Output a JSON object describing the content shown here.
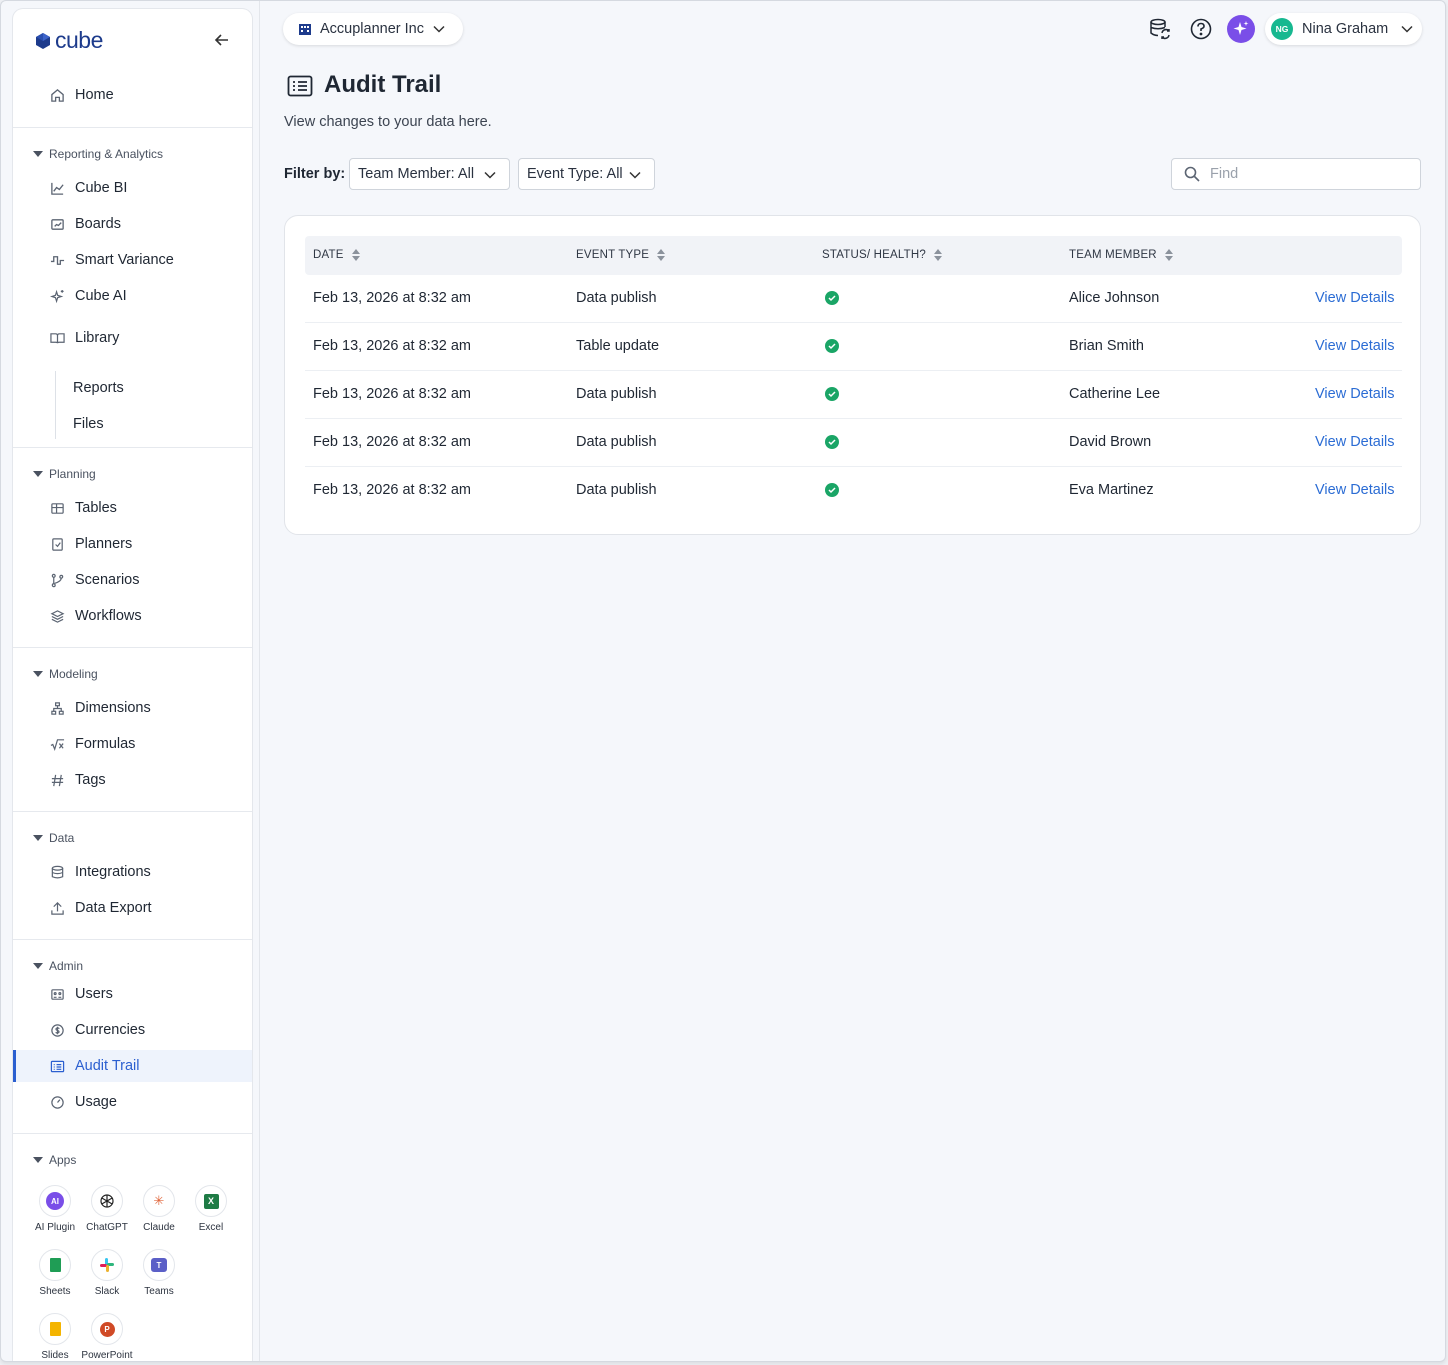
{
  "sidebar": {
    "logo_text": "cube",
    "home": "Home",
    "sections": {
      "reporting": "Reporting & Analytics",
      "planning": "Planning",
      "modeling": "Modeling",
      "data": "Data",
      "admin": "Admin",
      "apps": "Apps"
    },
    "reporting_items": [
      "Cube BI",
      "Boards",
      "Smart Variance",
      "Cube AI",
      "Library"
    ],
    "library_sub": [
      "Reports",
      "Files"
    ],
    "planning_items": [
      "Tables",
      "Planners",
      "Scenarios",
      "Workflows"
    ],
    "modeling_items": [
      "Dimensions",
      "Formulas",
      "Tags"
    ],
    "data_items": [
      "Integrations",
      "Data Export"
    ],
    "admin_items": [
      "Users",
      "Currencies",
      "Audit Trail",
      "Usage"
    ],
    "active_item": "Audit Trail",
    "apps": [
      "AI Plugin",
      "ChatGPT",
      "Claude",
      "Excel",
      "Sheets",
      "Slack",
      "Teams",
      "Slides",
      "PowerPoint"
    ]
  },
  "topbar": {
    "org": "Accuplanner Inc",
    "user_initials": "NG",
    "user_name": "Nina Graham"
  },
  "page": {
    "title": "Audit Trail",
    "subtitle": "View changes to your data here.",
    "filter_label": "Filter by:",
    "team_filter": "Team Member: All",
    "event_filter": "Event Type: All",
    "search_placeholder": "Find"
  },
  "table": {
    "headers": [
      "DATE",
      "EVENT TYPE",
      "STATUS/ HEALTH?",
      "TEAM MEMBER"
    ],
    "rows": [
      {
        "date": "Feb 13, 2026 at 8:32 am",
        "event": "Data publish",
        "status": "ok",
        "member": "Alice Johnson",
        "action": "View Details"
      },
      {
        "date": "Feb 13, 2026 at 8:32 am",
        "event": "Table update",
        "status": "ok",
        "member": "Brian Smith",
        "action": "View Details"
      },
      {
        "date": "Feb 13, 2026 at 8:32 am",
        "event": "Data publish",
        "status": "ok",
        "member": "Catherine Lee",
        "action": "View Details"
      },
      {
        "date": "Feb 13, 2026 at 8:32 am",
        "event": "Data publish",
        "status": "ok",
        "member": "David Brown",
        "action": "View Details"
      },
      {
        "date": "Feb 13, 2026 at 8:32 am",
        "event": "Data publish",
        "status": "ok",
        "member": "Eva Martinez",
        "action": "View Details"
      }
    ]
  },
  "colors": {
    "accent": "#2b5fd0",
    "link": "#2b6cd4",
    "status_ok": "#1aa566",
    "avatar": "#17b890",
    "ai_button": "#7a4ee8"
  }
}
